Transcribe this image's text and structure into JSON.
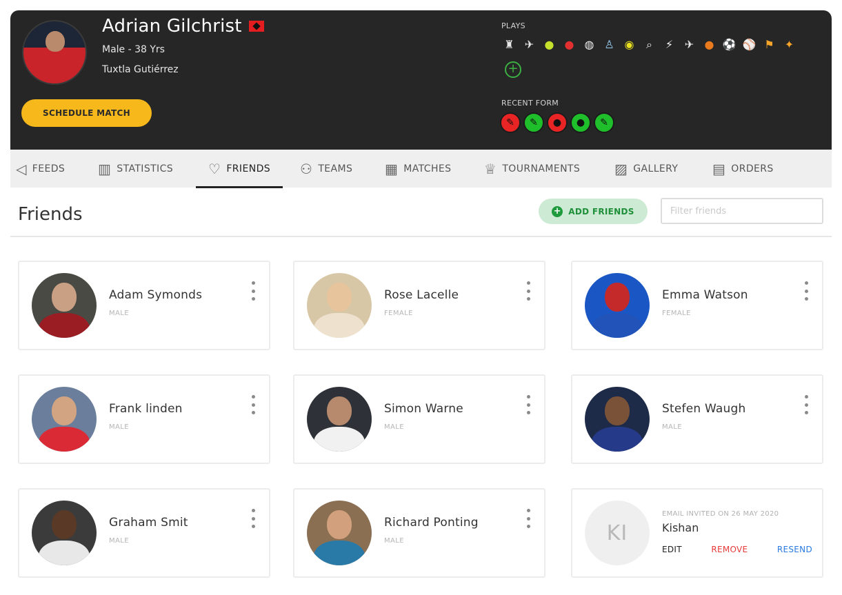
{
  "profile": {
    "name": "Adrian Gilchrist",
    "gender_age": "Male - 38 Yrs",
    "city": "Tuxtla Gutiérrez",
    "schedule_label": "SCHEDULE MATCH"
  },
  "plays": {
    "label": "PLAYS",
    "icons": [
      {
        "name": "chess-icon",
        "glyph": "♜",
        "color": "#e8e8e8",
        "bg": "transparent"
      },
      {
        "name": "shuttlecock-icon",
        "glyph": "✈",
        "color": "#e8e8e8",
        "bg": "transparent"
      },
      {
        "name": "tennis-ball-icon",
        "glyph": "●",
        "color": "#c6e12b",
        "bg": "transparent"
      },
      {
        "name": "table-tennis-icon",
        "glyph": "●",
        "color": "#e23030",
        "bg": "transparent"
      },
      {
        "name": "volleyball-icon",
        "glyph": "◍",
        "color": "#f2f2f2",
        "bg": "transparent"
      },
      {
        "name": "badminton-icon",
        "glyph": "♙",
        "color": "#9ad0f5",
        "bg": "transparent"
      },
      {
        "name": "pickleball-icon",
        "glyph": "◉",
        "color": "#e8e021",
        "bg": "transparent"
      },
      {
        "name": "racket-icon",
        "glyph": "⌕",
        "color": "#e8e8e8",
        "bg": "transparent"
      },
      {
        "name": "squash-icon",
        "glyph": "⚡",
        "color": "#f5f5f5",
        "bg": "transparent"
      },
      {
        "name": "paper-plane-icon",
        "glyph": "✈",
        "color": "#e8e8e8",
        "bg": "transparent"
      },
      {
        "name": "basketball-icon",
        "glyph": "●",
        "color": "#ea7a1e",
        "bg": "transparent"
      },
      {
        "name": "football-icon",
        "glyph": "⚽",
        "color": "#f5f5f5",
        "bg": "transparent"
      },
      {
        "name": "cricket-icon",
        "glyph": "⚾",
        "color": "#f4a52a",
        "bg": "transparent"
      },
      {
        "name": "running-icon",
        "glyph": "⚑",
        "color": "#f4a52a",
        "bg": "transparent"
      },
      {
        "name": "yoga-icon",
        "glyph": "✦",
        "color": "#f4a52a",
        "bg": "transparent"
      }
    ],
    "add_label": "+"
  },
  "recent_form": {
    "label": "RECENT FORM",
    "results": [
      {
        "name": "form-loss-icon",
        "glyph": "✎",
        "bg": "#e82424"
      },
      {
        "name": "form-win-icon",
        "glyph": "✎",
        "bg": "#1fbf2b"
      },
      {
        "name": "form-loss-icon",
        "glyph": "●",
        "bg": "#e82424"
      },
      {
        "name": "form-win-icon",
        "glyph": "●",
        "bg": "#1fbf2b"
      },
      {
        "name": "form-win-icon",
        "glyph": "✎",
        "bg": "#1fbf2b"
      }
    ]
  },
  "tabs": [
    {
      "label": "FEEDS",
      "icon": "megaphone-icon",
      "glyph": "◁"
    },
    {
      "label": "STATISTICS",
      "icon": "chart-icon",
      "glyph": "▥"
    },
    {
      "label": "FRIENDS",
      "icon": "handshake-icon",
      "glyph": "♡"
    },
    {
      "label": "TEAMS",
      "icon": "team-icon",
      "glyph": "⚇"
    },
    {
      "label": "MATCHES",
      "icon": "calendar-icon",
      "glyph": "▦"
    },
    {
      "label": "TOURNAMENTS",
      "icon": "trophy-icon",
      "glyph": "♕"
    },
    {
      "label": "GALLERY",
      "icon": "image-icon",
      "glyph": "▨"
    },
    {
      "label": "ORDERS",
      "icon": "receipt-icon",
      "glyph": "▤"
    }
  ],
  "active_tab": "FRIENDS",
  "page": {
    "title": "Friends",
    "add_friends_label": "ADD FRIENDS",
    "filter_placeholder": "Filter friends"
  },
  "friends": [
    {
      "name": "Adam Symonds",
      "gender": "MALE"
    },
    {
      "name": "Rose Lacelle",
      "gender": "FEMALE"
    },
    {
      "name": "Emma Watson",
      "gender": "FEMALE"
    },
    {
      "name": "Frank linden",
      "gender": "MALE"
    },
    {
      "name": "Simon Warne",
      "gender": "MALE"
    },
    {
      "name": "Stefen Waugh",
      "gender": "MALE"
    },
    {
      "name": "Graham Smit",
      "gender": "MALE"
    },
    {
      "name": "Richard Ponting",
      "gender": "MALE"
    }
  ],
  "invite": {
    "initials": "KI",
    "note": "EMAIL INVITED ON 26 MAY 2020",
    "name": "Kishan",
    "edit_label": "EDIT",
    "remove_label": "REMOVE",
    "resend_label": "RESEND"
  }
}
